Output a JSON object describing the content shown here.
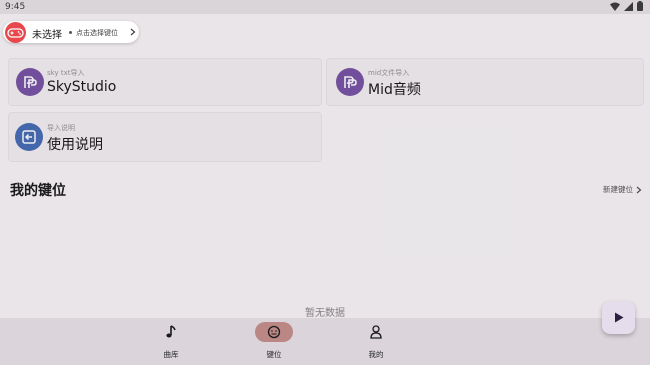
{
  "status_bar": {
    "time": "9:45",
    "icons": [
      "wifi-icon",
      "signal-icon",
      "battery-icon"
    ]
  },
  "cards": [
    {
      "subtitle": "sky txt导入",
      "title": "SkyStudio",
      "icon": "skystudio-logo-icon",
      "color": "#7a55a8"
    },
    {
      "subtitle": "mid文件导入",
      "title": "Mid音频",
      "icon": "mid-logo-icon",
      "color": "#7a55a8"
    },
    {
      "subtitle": "导入说明",
      "title": "使用说明",
      "icon": "import-guide-icon",
      "color": "#4a6fb8"
    }
  ],
  "section": {
    "title": "我的键位",
    "action_label": "新建键位"
  },
  "empty_state": "暂无数据",
  "bottom_nav": {
    "items": [
      {
        "label": "曲库",
        "icon": "music-note-icon",
        "active": false
      },
      {
        "label": "键位",
        "icon": "gamepad-icon",
        "active": true
      },
      {
        "label": "我的",
        "icon": "person-icon",
        "active": false
      }
    ]
  },
  "floating_pill": {
    "status": "未选择",
    "hint": "点击选择键位",
    "icon": "gamepad-avatar-icon"
  },
  "fab": {
    "icon": "play-icon"
  },
  "colors": {
    "accent_purple": "#7a55a8",
    "accent_blue": "#4a6fb8",
    "active_nav": "#c9928f",
    "avatar_red": "#e8484d"
  }
}
